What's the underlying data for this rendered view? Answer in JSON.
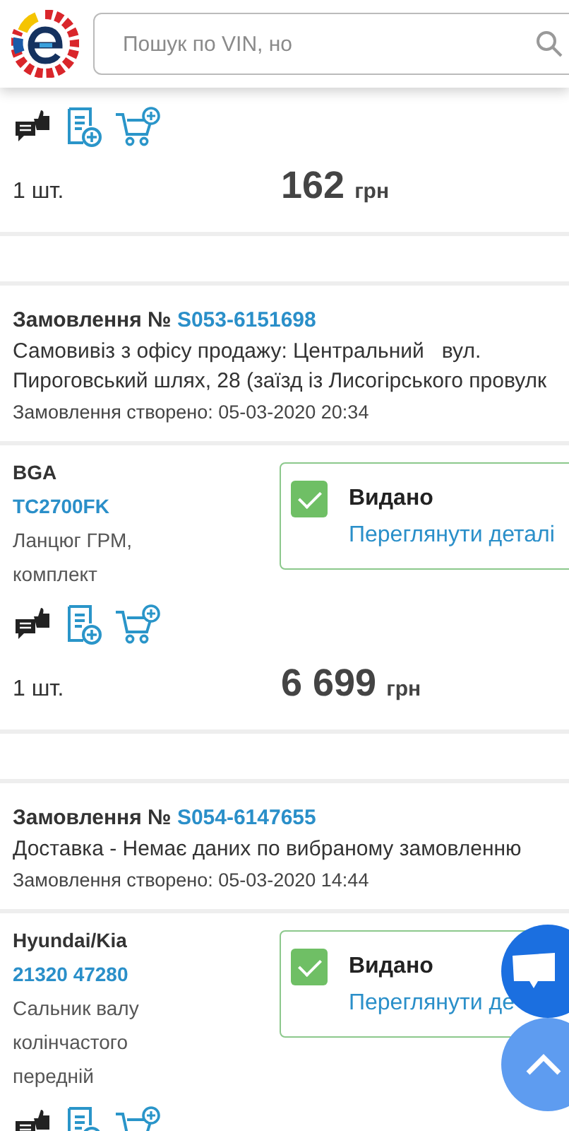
{
  "header": {
    "search": {
      "placeholder": "Пошук по VIN, но"
    }
  },
  "orders": [
    {
      "items": [
        {
          "quantity": "1 шт.",
          "price": "162",
          "currency": "грн"
        }
      ]
    },
    {
      "title": "Замовлення №",
      "number": "S053-6151698",
      "delivery_lines": [
        "Самовивіз з офісу продажу: Центральний   вул.",
        "Пироговський шлях, 28 (заїзд із Лисогірського провулк"
      ],
      "created": "Замовлення створено: 05-03-2020 20:34",
      "items": [
        {
          "brand": "BGA",
          "code": "TC2700FK",
          "description_lines": [
            "Ланцюг ГРМ,",
            "комплект"
          ],
          "status": {
            "issued": true,
            "label": "Видано",
            "link": "Переглянути деталі"
          },
          "quantity": "1 шт.",
          "price": "6 699",
          "currency": "грн"
        }
      ]
    },
    {
      "title": "Замовлення №",
      "number": "S054-6147655",
      "delivery_lines": [
        "Доставка - Немає даних по вибраному замовленню"
      ],
      "created": "Замовлення створено: 05-03-2020 14:44",
      "items": [
        {
          "brand": "Hyundai/Kia",
          "code": "21320 47280",
          "description_lines": [
            "Сальник валу",
            "колінчастого",
            "передній"
          ],
          "status": {
            "issued": true,
            "label": "Видано",
            "link": "Переглянути де"
          }
        }
      ]
    }
  ]
}
